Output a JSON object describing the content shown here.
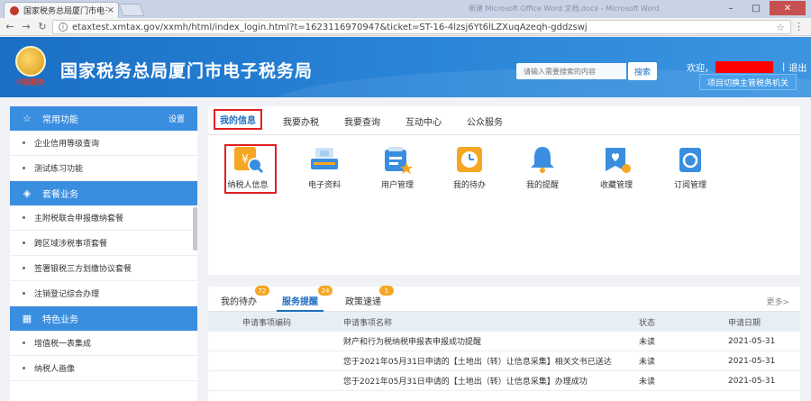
{
  "browser": {
    "tab_title": "国家税务总局厦门市电子",
    "tab_close": "×",
    "window_title": "新建 Microsoft Office Word 文档.docx - Microsoft Word",
    "controls": [
      "–",
      "□",
      "✕"
    ],
    "url": "etaxtest.xmtax.gov/xxmh/html/index_login.html?t=1623116970947&ticket=ST-16-4lzsj6Yt6lLZXuqAzeqh-gddzswj"
  },
  "header": {
    "seal_text": "中国税务",
    "title": "国家税务总局厦门市电子税务局",
    "search_placeholder": "请输入需要搜索的内容",
    "search_button": "搜索",
    "welcome": "欢迎，",
    "separator": "|",
    "logout": "退出",
    "switch_button": "项目切换主管税务机关"
  },
  "sidebar": {
    "sections": [
      {
        "title": "常用功能",
        "action": "设置",
        "icon": "star-icon",
        "items": [
          "企业信用等级查询",
          "测试练习功能"
        ]
      },
      {
        "title": "套餐业务",
        "icon": "layers-icon",
        "items": [
          "主附税联合申报缴纳套餐",
          "跨区域涉税事项套餐",
          "签署银税三方划缴协议套餐",
          "注销登记综合办理"
        ]
      },
      {
        "title": "特色业务",
        "icon": "grid-icon",
        "items": [
          "增值税一表集成",
          "纳税人画像"
        ]
      }
    ]
  },
  "my_info": {
    "tabs": [
      "我的信息",
      "我要办税",
      "我要查询",
      "互动中心",
      "公众服务"
    ],
    "active_tab": "我的信息",
    "icons": [
      {
        "label": "纳税人信息",
        "icon": "taxpayer-info-icon",
        "color": "#f5a623"
      },
      {
        "label": "电子资料",
        "icon": "scanner-icon",
        "color": "#3a8ee0"
      },
      {
        "label": "用户管理",
        "icon": "user-manage-icon",
        "color": "#3a8ee0"
      },
      {
        "label": "我的待办",
        "icon": "clock-icon",
        "color": "#f5a623"
      },
      {
        "label": "我的提醒",
        "icon": "bell-icon",
        "color": "#3a8ee0"
      },
      {
        "label": "收藏管理",
        "icon": "favorite-icon",
        "color": "#3a8ee0"
      },
      {
        "label": "订阅管理",
        "icon": "subscribe-icon",
        "color": "#3a8ee0"
      }
    ]
  },
  "notices": {
    "tabs": [
      {
        "label": "我的待办",
        "badge": "72"
      },
      {
        "label": "服务提醒",
        "badge": "24"
      },
      {
        "label": "政策速递",
        "badge": "1"
      }
    ],
    "active_tab": "服务提醒",
    "more": "更多>",
    "columns": [
      "申请事项编码",
      "申请事项名称",
      "状态",
      "申请日期"
    ],
    "rows": [
      {
        "code": "",
        "name": "财产和行为税纳税申报表申报成功提醒",
        "status": "未读",
        "date": "2021-05-31"
      },
      {
        "code": "",
        "name": "您于2021年05月31日申请的【土地出（转）让信息采集】相关文书已送达",
        "status": "未读",
        "date": "2021-05-31"
      },
      {
        "code": "",
        "name": "您于2021年05月31日申请的【土地出（转）让信息采集】办理成功",
        "status": "未读",
        "date": "2021-05-31"
      }
    ]
  }
}
